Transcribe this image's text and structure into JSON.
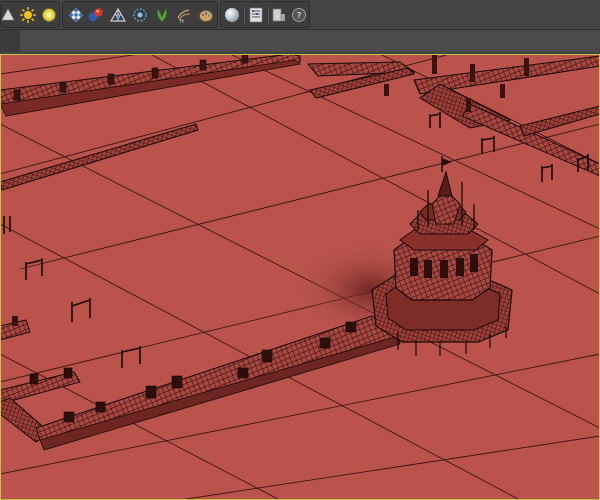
{
  "window": {
    "title": ""
  },
  "toolbar": {
    "tools": [
      {
        "name": "cone-light-icon"
      },
      {
        "name": "sun-light-icon"
      },
      {
        "name": "sphere-light-icon"
      },
      {
        "name": "checker-material-icon"
      },
      {
        "name": "shader-ball-icon"
      },
      {
        "name": "uv-editor-icon"
      },
      {
        "name": "particle-icon"
      },
      {
        "name": "foliage-icon"
      },
      {
        "name": "hair-icon"
      },
      {
        "name": "paint-icon"
      },
      {
        "name": "render-sphere-icon"
      },
      {
        "name": "render-settings-icon"
      },
      {
        "name": "render-frame-icon"
      },
      {
        "name": "help-icon"
      }
    ]
  },
  "viewport": {
    "mode": "wireframe-on-shaded",
    "background_color": "#b9534c",
    "wire_color": "#1a0a08",
    "grid_color": "#3e1612",
    "frame_color": "#c8c24a"
  }
}
